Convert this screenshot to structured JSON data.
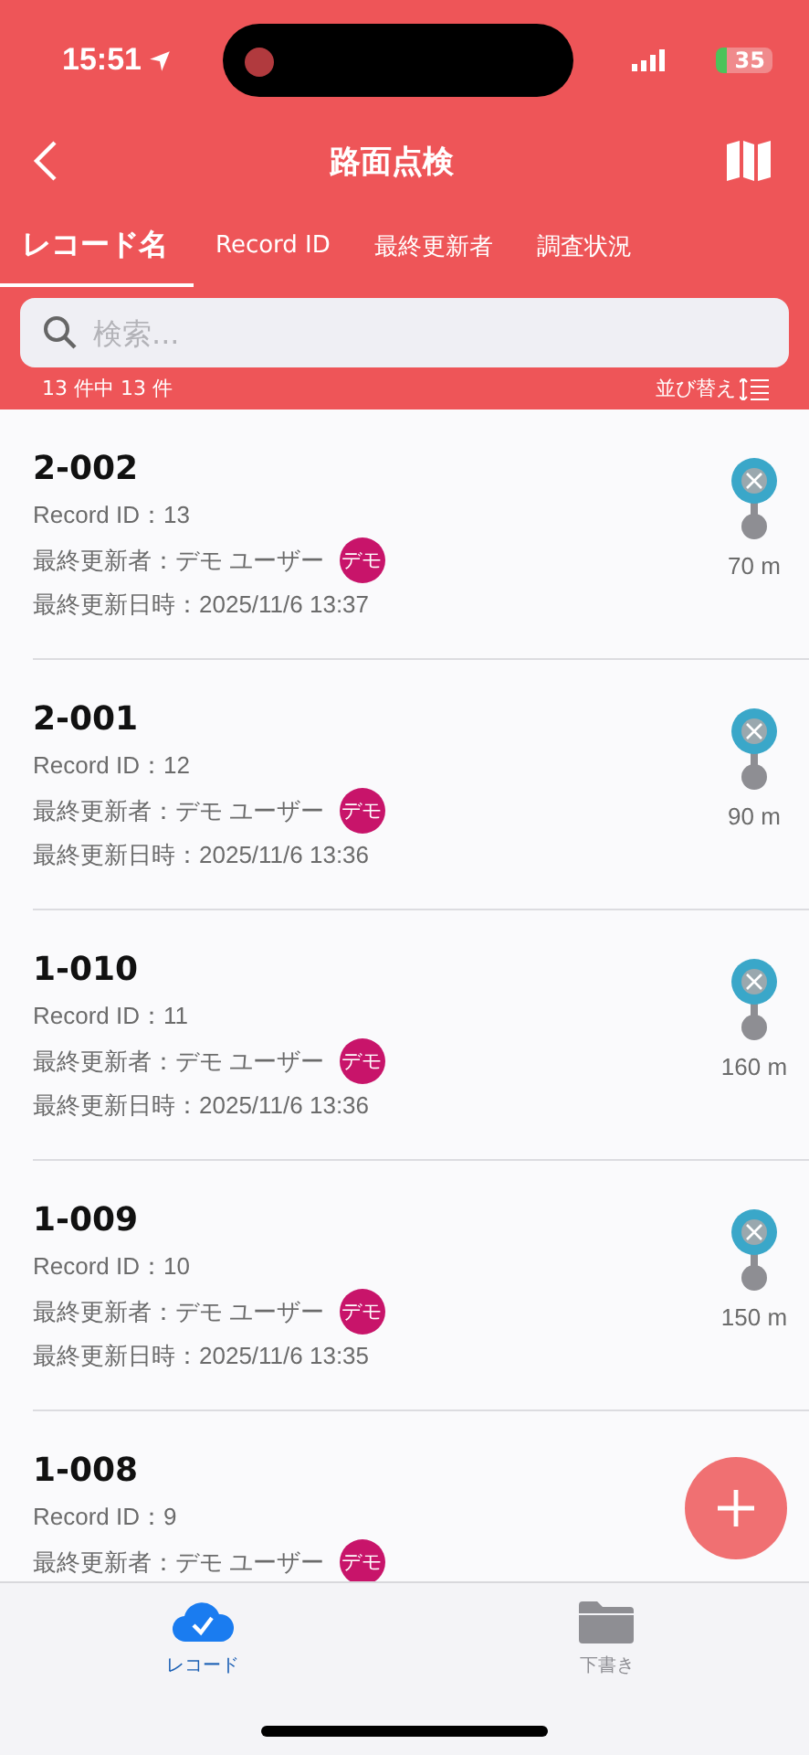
{
  "status_bar": {
    "time": "15:51",
    "battery": "35"
  },
  "nav": {
    "title": "路面点検"
  },
  "tabs": [
    {
      "label": "レコード名",
      "selected": true
    },
    {
      "label": "Record ID",
      "selected": false
    },
    {
      "label": "最終更新者",
      "selected": false
    },
    {
      "label": "調査状況",
      "selected": false
    }
  ],
  "search": {
    "placeholder": "検索..."
  },
  "count": "13 件中 13 件",
  "sort": "並び替え",
  "records": [
    {
      "name": "2-002",
      "record_id": "Record ID：13",
      "updater": "最終更新者：デモ ユーザー",
      "avatar": "デモ",
      "updated": "最終更新日時：2025/11/6 13:37",
      "distance": "70 m"
    },
    {
      "name": "2-001",
      "record_id": "Record ID：12",
      "updater": "最終更新者：デモ ユーザー",
      "avatar": "デモ",
      "updated": "最終更新日時：2025/11/6 13:36",
      "distance": "90 m"
    },
    {
      "name": "1-010",
      "record_id": "Record ID：11",
      "updater": "最終更新者：デモ ユーザー",
      "avatar": "デモ",
      "updated": "最終更新日時：2025/11/6 13:36",
      "distance": "160 m"
    },
    {
      "name": "1-009",
      "record_id": "Record ID：10",
      "updater": "最終更新者：デモ ユーザー",
      "avatar": "デモ",
      "updated": "最終更新日時：2025/11/6 13:35",
      "distance": "150 m"
    },
    {
      "name": "1-008",
      "record_id": "Record ID：9",
      "updater": "最終更新者：デモ ユーザー",
      "avatar": "デモ"
    }
  ],
  "bottom_tabs": [
    {
      "label": "レコード",
      "kind": "cloud",
      "selected": true
    },
    {
      "label": "下書き",
      "kind": "folder",
      "selected": false
    }
  ]
}
